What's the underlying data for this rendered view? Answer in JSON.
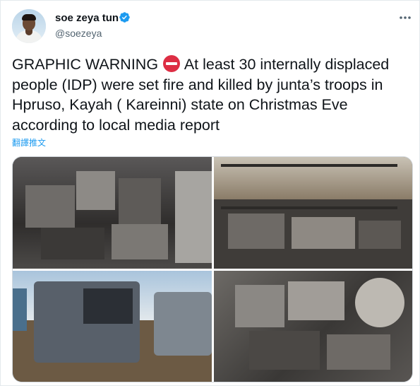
{
  "user": {
    "display_name": "soe zeya tun",
    "handle": "@soezeya",
    "verified": true
  },
  "tweet": {
    "text_before": "GRAPHIC WARNING",
    "text_after": "At least 30 internally displaced people (IDP) were set fire and killed by junta’s troops in Hpruso, Kayah ( Kareinni) state on Christmas Eve according to local media report",
    "emoji": "no-entry-icon",
    "translate_label": "翻譯推文"
  },
  "icons": {
    "more": "more-options-icon",
    "verified": "verified-badge-icon"
  },
  "colors": {
    "verified_blue": "#1d9bf0",
    "link_blue": "#1d9bf0",
    "no_entry_red": "#dd2e44",
    "secondary_text": "#536471"
  },
  "media": {
    "photo_count": 4
  }
}
